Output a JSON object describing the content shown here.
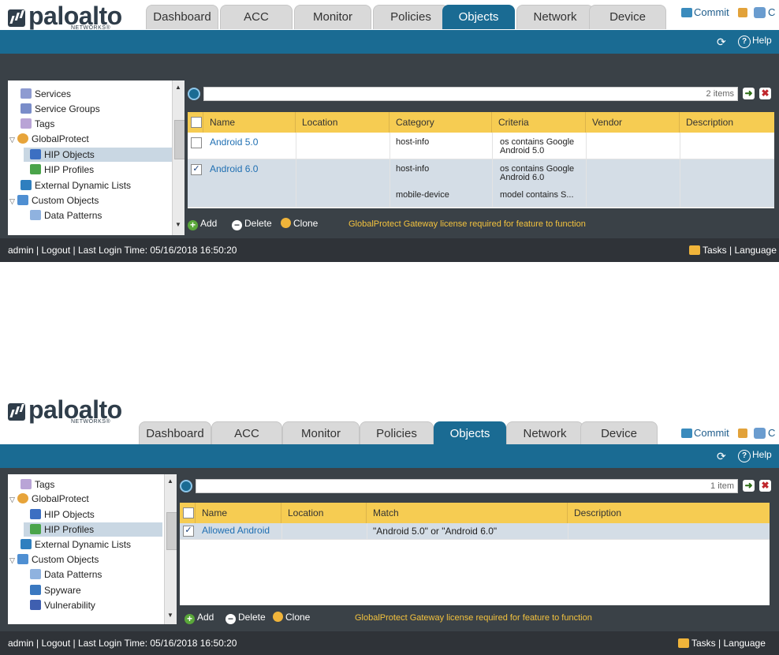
{
  "brand": {
    "name": "paloalto",
    "sub": "NETWORKS®"
  },
  "tabs": [
    "Dashboard",
    "ACC",
    "Monitor",
    "Policies",
    "Objects",
    "Network",
    "Device"
  ],
  "header_right": {
    "commit": "Commit",
    "config_initial": "C"
  },
  "toolbar": {
    "help": "Help"
  },
  "colors": {
    "tab_active": "#1a6b93",
    "header_row": "#f6cc52",
    "license_text": "#f3c23e",
    "dark_bar": "#3a4147"
  },
  "top": {
    "tree": [
      {
        "label": "Services",
        "icon": "services-icon"
      },
      {
        "label": "Service Groups",
        "icon": "service-groups-icon"
      },
      {
        "label": "Tags",
        "icon": "tag-icon"
      },
      {
        "label": "GlobalProtect",
        "icon": "globalprotect-icon",
        "expanded": true
      },
      {
        "label": "HIP Objects",
        "icon": "hip-objects-icon",
        "selected": true
      },
      {
        "label": "HIP Profiles",
        "icon": "hip-profiles-icon"
      },
      {
        "label": "External Dynamic Lists",
        "icon": "edl-icon"
      },
      {
        "label": "Custom Objects",
        "icon": "custom-objects-icon",
        "expanded": true
      },
      {
        "label": "Data Patterns",
        "icon": "data-patterns-icon"
      }
    ],
    "search": {
      "count": "2 items"
    },
    "columns": [
      "Name",
      "Location",
      "Category",
      "Criteria",
      "Vendor",
      "Description"
    ],
    "rows": [
      {
        "name": "Android 5.0",
        "checked": false,
        "category": [
          "host-info"
        ],
        "criteria": [
          "os contains Google Android 5.0"
        ]
      },
      {
        "name": "Android 6.0",
        "checked": true,
        "category": [
          "host-info",
          "mobile-device"
        ],
        "criteria": [
          "os contains Google Android 6.0",
          "model contains S..."
        ]
      }
    ]
  },
  "bottom": {
    "tree": [
      {
        "label": "Tags",
        "icon": "tag-icon"
      },
      {
        "label": "GlobalProtect",
        "icon": "globalprotect-icon",
        "expanded": true
      },
      {
        "label": "HIP Objects",
        "icon": "hip-objects-icon"
      },
      {
        "label": "HIP Profiles",
        "icon": "hip-profiles-icon",
        "selected": true
      },
      {
        "label": "External Dynamic Lists",
        "icon": "edl-icon"
      },
      {
        "label": "Custom Objects",
        "icon": "custom-objects-icon",
        "expanded": true
      },
      {
        "label": "Data Patterns",
        "icon": "data-patterns-icon"
      },
      {
        "label": "Spyware",
        "icon": "spyware-icon"
      },
      {
        "label": "Vulnerability",
        "icon": "vulnerability-icon"
      }
    ],
    "search": {
      "count": "1 item"
    },
    "columns": [
      "Name",
      "Location",
      "Match",
      "Description"
    ],
    "rows": [
      {
        "name": "Allowed Android",
        "checked": true,
        "match": "\"Android 5.0\" or \"Android 6.0\""
      }
    ]
  },
  "actions": {
    "add": "Add",
    "delete": "Delete",
    "clone": "Clone"
  },
  "license_msg": "GlobalProtect Gateway license required for feature to function",
  "footer": {
    "user": "admin",
    "logout": "Logout",
    "last_login": "Last Login Time: 05/16/2018 16:50:20",
    "tasks": "Tasks",
    "language": "Language"
  }
}
